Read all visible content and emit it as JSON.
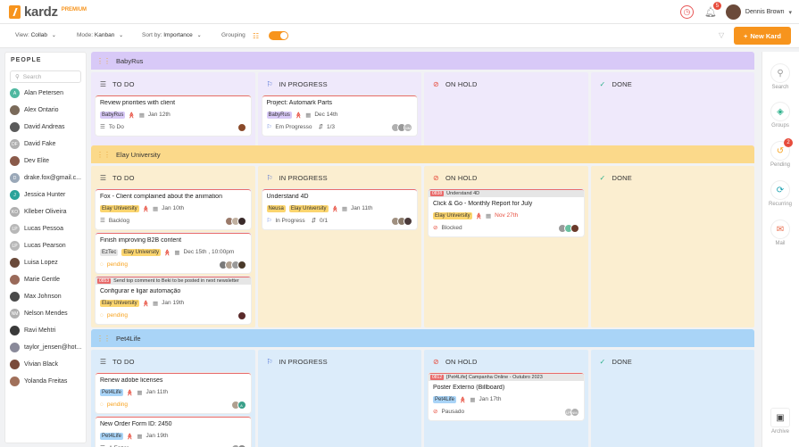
{
  "app": {
    "logo": "kardz",
    "edition": "PREMIUM"
  },
  "header": {
    "notifications_count": "5",
    "user_name": "Dennis Brown"
  },
  "toolbar": {
    "view_label": "View:",
    "view_value": "Collab",
    "mode_label": "Mode:",
    "mode_value": "Kanban",
    "sort_label": "Sort by:",
    "sort_value": "Importance",
    "grouping_label": "Grouping",
    "new_button": "New Kard"
  },
  "people": {
    "title": "PEOPLE",
    "search_placeholder": "Search",
    "items": [
      {
        "name": "Alan Petersen",
        "initials": "A",
        "color": "#4fb8a0"
      },
      {
        "name": "Alex Ontario",
        "initials": "",
        "color": "#7a6a5a"
      },
      {
        "name": "David Andreas",
        "initials": "",
        "color": "#5a5a5a"
      },
      {
        "name": "David Fake",
        "initials": "DF",
        "color": "#b0b0b0"
      },
      {
        "name": "Dev Elite",
        "initials": "",
        "color": "#8a5a4a"
      },
      {
        "name": "drake.fox@gmail.c...",
        "initials": "D",
        "color": "#9aa8b8"
      },
      {
        "name": "Jessica Hunter",
        "initials": "J",
        "color": "#2aa39a"
      },
      {
        "name": "Klleber Oliveira",
        "initials": "KO",
        "color": "#b0b0b0"
      },
      {
        "name": "Lucas Pessoa",
        "initials": "LP",
        "color": "#b8b8b8"
      },
      {
        "name": "Lucas Pearson",
        "initials": "LP",
        "color": "#b8b8b8"
      },
      {
        "name": "Luisa Lopez",
        "initials": "",
        "color": "#6a4a3a"
      },
      {
        "name": "Marie Gentle",
        "initials": "",
        "color": "#9a6a5a"
      },
      {
        "name": "Max Johnson",
        "initials": "",
        "color": "#4a4a4a"
      },
      {
        "name": "Nelson Mendes",
        "initials": "NM",
        "color": "#b0b0b0"
      },
      {
        "name": "Ravi Mehtri",
        "initials": "",
        "color": "#3a3a3a"
      },
      {
        "name": "taylor_jensen@hot...",
        "initials": "",
        "color": "#8a8a9a"
      },
      {
        "name": "Vivian Black",
        "initials": "",
        "color": "#7a4a3a"
      },
      {
        "name": "Yolanda Freitas",
        "initials": "",
        "color": "#a0705a"
      }
    ]
  },
  "columns": {
    "todo": "TO DO",
    "in_progress": "IN PROGRESS",
    "on_hold": "ON HOLD",
    "done": "DONE"
  },
  "groups": [
    {
      "name": "BabyRus",
      "head_color": "#d8c9f7",
      "body_color": "#efe9fb",
      "cards": {
        "todo": [
          {
            "title": "Review priorities with client",
            "tags": [
              {
                "label": "BabyRus",
                "color": "#d8c9f7"
              }
            ],
            "date": "Jan 12th",
            "status": "To Do",
            "status_type": "flag",
            "avatars": [
              "#8a4a2a"
            ]
          }
        ],
        "in_progress": [
          {
            "title": "Project: Automark Parts",
            "tags": [
              {
                "label": "BabyRus",
                "color": "#d8c9f7"
              }
            ],
            "date": "Dec 14th",
            "status": "Em Progresso",
            "subtasks": "1/3",
            "avatars": [
              "#b0b0b0",
              "#999",
              "#b5b5b5"
            ],
            "avatar_initials": [
              "",
              "",
              "NM"
            ]
          }
        ]
      }
    },
    {
      "name": "Elay University",
      "head_color": "#fbd98a",
      "body_color": "#fbeed0",
      "cards": {
        "todo": [
          {
            "title": "Fox - Client complained about the animation",
            "tags": [
              {
                "label": "Elay University",
                "color": "#fbd56e"
              }
            ],
            "date": "Jan 10th",
            "status": "Backlog",
            "avatars": [
              "#9a7a6a",
              "#c0b0a0",
              "#3a2a2a"
            ]
          },
          {
            "title": "Finish improving B2B content",
            "tags": [
              {
                "label": "EzTec",
                "color": "#e6e6e6"
              },
              {
                "label": "Elay University",
                "color": "#fbd56e"
              }
            ],
            "date": "Dec 15th , 10:00pm",
            "status": "pending",
            "avatars": [
              "#7a7a7a",
              "#b0a090",
              "#9a9a9a",
              "#4a3a2a"
            ]
          },
          {
            "ref_code": "0853",
            "ref_text": "Send top comment to Beki to be posted in next newsletter",
            "title": "Configurar e ligar automação",
            "tags": [
              {
                "label": "Elay University",
                "color": "#fbd56e"
              }
            ],
            "date": "Jan 19th",
            "status": "pending",
            "avatars": [
              "#5a2a2a"
            ]
          }
        ],
        "in_progress": [
          {
            "title": "Understand 4D",
            "tags": [
              {
                "label": "Neusa",
                "color": "#fbd56e"
              },
              {
                "label": "Elay University",
                "color": "#fbd56e"
              }
            ],
            "date": "Jan 11th",
            "status": "In Progress",
            "subtasks": "0/1",
            "avatars": [
              "#a09080",
              "#8a7a6a",
              "#4a3a3a"
            ]
          }
        ],
        "on_hold": [
          {
            "ref_code": "0838",
            "ref_text": "Understand 4D",
            "title": "Click & Go - Monthly Report for July",
            "tags": [
              {
                "label": "Elay University",
                "color": "#fbd56e"
              }
            ],
            "date": "Nov 27th",
            "date_red": true,
            "status": "Blocked",
            "avatars": [
              "#9a9a9a",
              "#6ac0a0",
              "#6a3a2a"
            ]
          }
        ]
      }
    },
    {
      "name": "Pet4Life",
      "head_color": "#a9d4f7",
      "body_color": "#dcecfa",
      "cards": {
        "todo": [
          {
            "title": "Renew adobe licenses",
            "tags": [
              {
                "label": "Pet4Life",
                "color": "#a9d4f7"
              }
            ],
            "date": "Jan 11th",
            "status": "pending",
            "avatars": [
              "#b0a090",
              "#3aa08a"
            ],
            "avatar_initials": [
              "",
              "A"
            ]
          },
          {
            "title": "New Order Form ID: 2450",
            "tags": [
              {
                "label": "Pet4Life",
                "color": "#a9d4f7"
              }
            ],
            "date": "Jan 19th",
            "status": "A Fazer",
            "avatars": [
              "#a0a0a0",
              "#8a8a8a"
            ]
          }
        ],
        "on_hold": [
          {
            "ref_code": "0812",
            "ref_text": "[Pet4Life] Campanha Online - Outubro 2023",
            "title": "Poster Externo (Billboard)",
            "tags": [
              {
                "label": "Pet4Life",
                "color": "#a9d4f7"
              }
            ],
            "date": "Jan 17th",
            "status": "Pausado",
            "avatars": [
              "#c0c0c0",
              "#b0b0b0"
            ],
            "avatar_initials": [
              "LP",
              "NM"
            ]
          }
        ]
      }
    }
  ],
  "rightbar": {
    "search": "Search",
    "groups": "Groups",
    "pending": "Pending",
    "pending_count": "2",
    "recurring": "Recurring",
    "mail": "Mail",
    "archive": "Archive"
  }
}
